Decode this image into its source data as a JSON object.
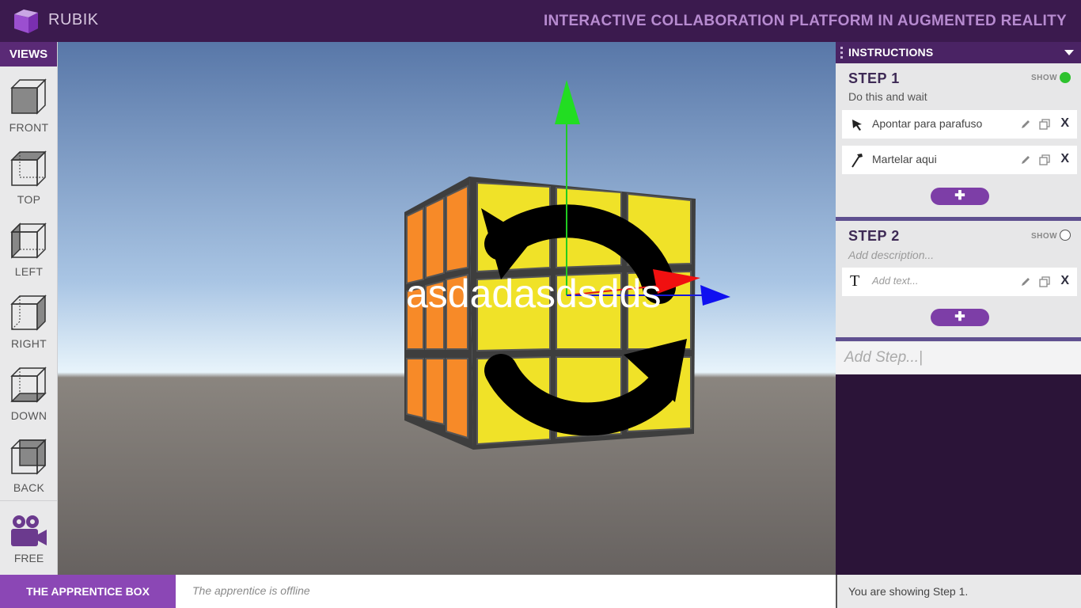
{
  "header": {
    "brand": "RUBIK",
    "tagline": "INTERACTIVE COLLABORATION PLATFORM IN AUGMENTED REALITY"
  },
  "views": {
    "title": "VIEWS",
    "items": [
      {
        "label": "FRONT",
        "icon": "cube-front-icon"
      },
      {
        "label": "TOP",
        "icon": "cube-top-icon"
      },
      {
        "label": "LEFT",
        "icon": "cube-left-icon"
      },
      {
        "label": "RIGHT",
        "icon": "cube-right-icon"
      },
      {
        "label": "DOWN",
        "icon": "cube-down-icon"
      },
      {
        "label": "BACK",
        "icon": "cube-back-icon"
      }
    ],
    "free_label": "FREE"
  },
  "scene": {
    "overlay_text": "asdadasdsdds"
  },
  "instructions": {
    "title": "INSTRUCTIONS",
    "steps": [
      {
        "title": "STEP 1",
        "show_label": "SHOW",
        "shown": true,
        "description": "Do this and wait",
        "items": [
          {
            "icon": "pointer-icon",
            "text": "Apontar para parafuso"
          },
          {
            "icon": "hammer-icon",
            "text": "Martelar aqui"
          }
        ],
        "add_label": "✚"
      },
      {
        "title": "STEP 2",
        "show_label": "SHOW",
        "shown": false,
        "description_placeholder": "Add description...",
        "items": [
          {
            "icon": "text-icon",
            "placeholder": "Add text..."
          }
        ],
        "add_label": "✚"
      }
    ],
    "add_step_placeholder": "Add Step...|",
    "delete_label": "X"
  },
  "bottom": {
    "apprentice_box": "THE APPRENTICE BOX",
    "apprentice_status": "The apprentice is offline",
    "showing_status": "You are showing Step 1."
  },
  "colors": {
    "header_bg": "#3b1a4e",
    "accent": "#8b47b5",
    "show_on": "#2ec22e",
    "cube_yellow": "#f0e228",
    "cube_orange": "#f78a28"
  }
}
